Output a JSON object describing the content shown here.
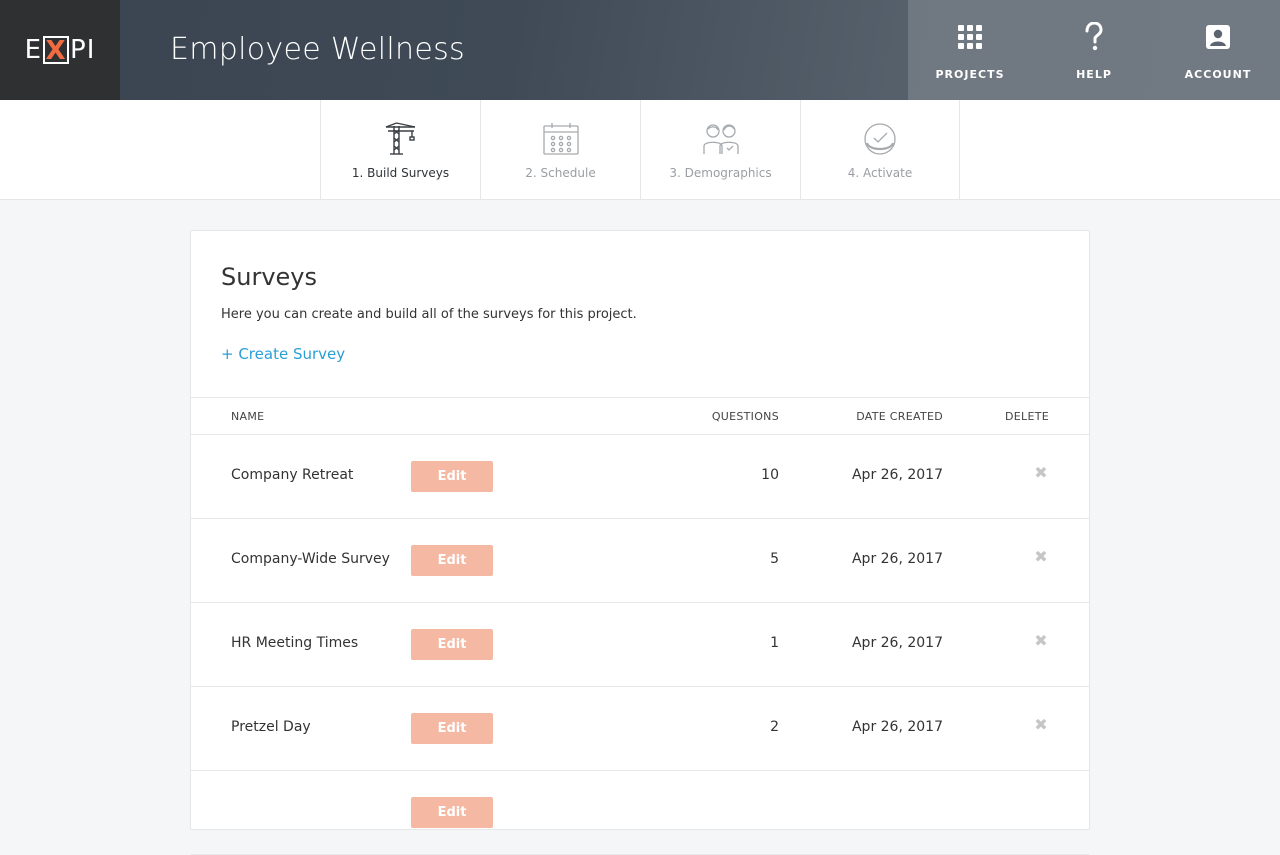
{
  "header": {
    "logo": {
      "left": "E",
      "mid": "X",
      "right": "PI"
    },
    "title": "Employee Wellness",
    "nav": [
      {
        "label": "PROJECTS",
        "icon": "grid-icon"
      },
      {
        "label": "HELP",
        "icon": "question-icon"
      },
      {
        "label": "ACCOUNT",
        "icon": "account-icon"
      }
    ]
  },
  "steps": [
    {
      "label": "1. Build Surveys",
      "icon": "crane-icon",
      "active": true
    },
    {
      "label": "2. Schedule",
      "icon": "calendar-icon",
      "active": false
    },
    {
      "label": "3. Demographics",
      "icon": "people-icon",
      "active": false
    },
    {
      "label": "4. Activate",
      "icon": "checkmark-icon",
      "active": false
    }
  ],
  "surveys": {
    "title": "Surveys",
    "description": "Here you can create and build all of the surveys for this project.",
    "create_label": "+ Create Survey",
    "columns": {
      "name": "NAME",
      "questions": "QUESTIONS",
      "date": "DATE CREATED",
      "delete": "DELETE"
    },
    "edit_label": "Edit",
    "delete_symbol": "✖",
    "rows": [
      {
        "name": "Company Retreat",
        "questions": "10",
        "date": "Apr 26, 2017"
      },
      {
        "name": "Company-Wide Survey",
        "questions": "5",
        "date": "Apr 26, 2017"
      },
      {
        "name": "HR Meeting Times",
        "questions": "1",
        "date": "Apr 26, 2017"
      },
      {
        "name": "Pretzel Day",
        "questions": "2",
        "date": "Apr 26, 2017"
      },
      {
        "name": "",
        "questions": "",
        "date": ""
      }
    ]
  },
  "colors": {
    "accent_link": "#2a9fd6",
    "edit_button": "#f5b8a3",
    "logo_x": "#f06b3f"
  }
}
